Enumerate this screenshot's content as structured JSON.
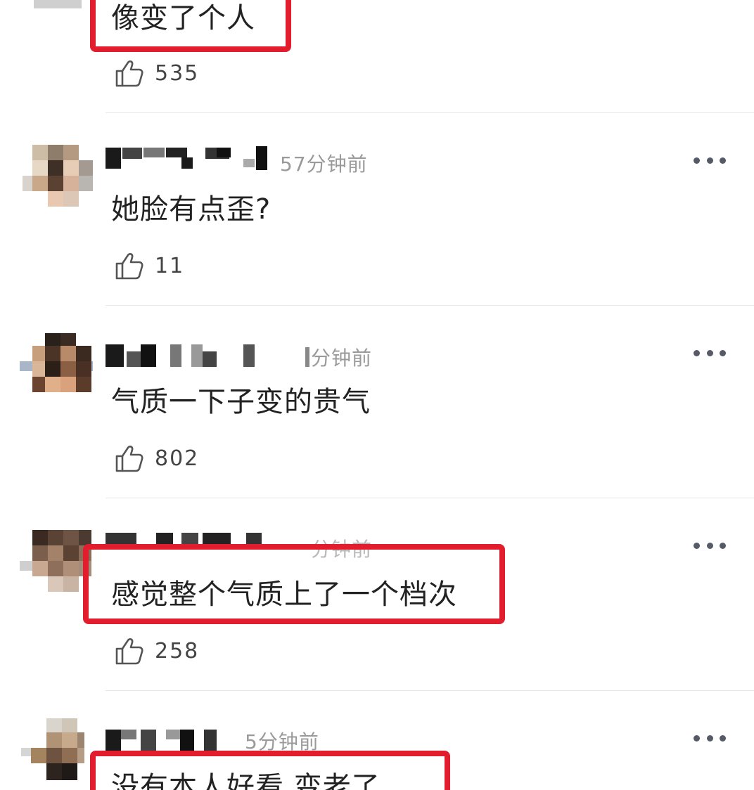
{
  "comments": [
    {
      "text": "像变了个人",
      "likes": "535",
      "highlighted": true
    },
    {
      "timestamp": "57分钟前",
      "text": "她脸有点歪?",
      "likes": "11",
      "highlighted": false
    },
    {
      "timestamp": "分钟前",
      "text": "气质一下子变的贵气",
      "likes": "802",
      "highlighted": false
    },
    {
      "timestamp": "分钟前",
      "text": "感觉整个气质上了一个档次",
      "likes": "258",
      "highlighted": true
    },
    {
      "timestamp": "5分钟前",
      "text": "没有本人好看 变老了",
      "highlighted": true
    }
  ],
  "colors": {
    "highlight": "#e21d2d",
    "text": "#222222",
    "muted": "#9a9a9a"
  },
  "icons": {
    "like": "thumbs-up-icon",
    "more": "more-dots-icon"
  }
}
